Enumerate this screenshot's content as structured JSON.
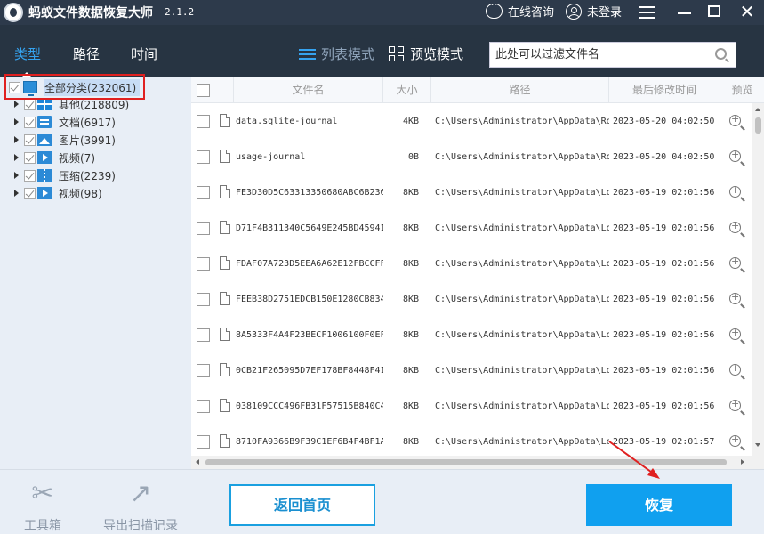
{
  "window": {
    "title": "蚂蚁文件数据恢复大师",
    "version": "2.1.2",
    "online_consult": "在线咨询",
    "login": "未登录"
  },
  "toolbar": {
    "tabs": [
      {
        "label": "类型",
        "active": true
      },
      {
        "label": "路径",
        "active": false
      },
      {
        "label": "时间",
        "active": false
      }
    ],
    "list_mode": "列表模式",
    "preview_mode": "预览模式",
    "filter_placeholder": "此处可以过滤文件名"
  },
  "tree": {
    "root": {
      "label": "全部分类(232061)",
      "icon": "monitor-icon"
    },
    "items": [
      {
        "label": "其他(218809)",
        "icon": "grid-icon"
      },
      {
        "label": "文档(6917)",
        "icon": "document-icon"
      },
      {
        "label": "图片(3991)",
        "icon": "picture-icon"
      },
      {
        "label": "视频(7)",
        "icon": "video-icon"
      },
      {
        "label": "压缩(2239)",
        "icon": "zip-icon"
      },
      {
        "label": "视频(98)",
        "icon": "video-icon"
      }
    ]
  },
  "table": {
    "columns": [
      "文件名",
      "大小",
      "路径",
      "最后修改时间",
      "预览"
    ],
    "rows": [
      {
        "name": "data.sqlite-journal",
        "size": "4KB",
        "path": "C:\\Users\\Administrator\\AppData\\Ro",
        "time": "2023-05-20 04:02:50"
      },
      {
        "name": "usage-journal",
        "size": "0B",
        "path": "C:\\Users\\Administrator\\AppData\\Ro",
        "time": "2023-05-20 04:02:50"
      },
      {
        "name": "FE3D30D5C63313350680ABC6B236",
        "size": "8KB",
        "path": "C:\\Users\\Administrator\\AppData\\Lo",
        "time": "2023-05-19 02:01:56"
      },
      {
        "name": "D71F4B311340C5649E245BD45941",
        "size": "8KB",
        "path": "C:\\Users\\Administrator\\AppData\\Lo",
        "time": "2023-05-19 02:01:56"
      },
      {
        "name": "FDAF07A723D5EEA6A62E12FBCCFF",
        "size": "8KB",
        "path": "C:\\Users\\Administrator\\AppData\\Lo",
        "time": "2023-05-19 02:01:56"
      },
      {
        "name": "FEEB38D2751EDCB150E1280CB834",
        "size": "8KB",
        "path": "C:\\Users\\Administrator\\AppData\\Lo",
        "time": "2023-05-19 02:01:56"
      },
      {
        "name": "8A5333F4A4F23BECF1006100F0EF",
        "size": "8KB",
        "path": "C:\\Users\\Administrator\\AppData\\Lo",
        "time": "2023-05-19 02:01:56"
      },
      {
        "name": "0CB21F265095D7EF178BF8448F41",
        "size": "8KB",
        "path": "C:\\Users\\Administrator\\AppData\\Lo",
        "time": "2023-05-19 02:01:56"
      },
      {
        "name": "038109CCC496FB31F57515B840C4",
        "size": "8KB",
        "path": "C:\\Users\\Administrator\\AppData\\Lo",
        "time": "2023-05-19 02:01:56"
      },
      {
        "name": "8710FA9366B9F39C1EF6B4F4BF1A",
        "size": "8KB",
        "path": "C:\\Users\\Administrator\\AppData\\Lo",
        "time": "2023-05-19 02:01:57"
      }
    ]
  },
  "bottom": {
    "toolbox": "工具箱",
    "export_log": "导出扫描记录",
    "home_button": "返回首页",
    "recover_button": "恢复"
  },
  "colors": {
    "titlebar": "#2d3a4b",
    "toolbar": "#273442",
    "accent": "#10a0ef",
    "highlight": "#e02020"
  }
}
